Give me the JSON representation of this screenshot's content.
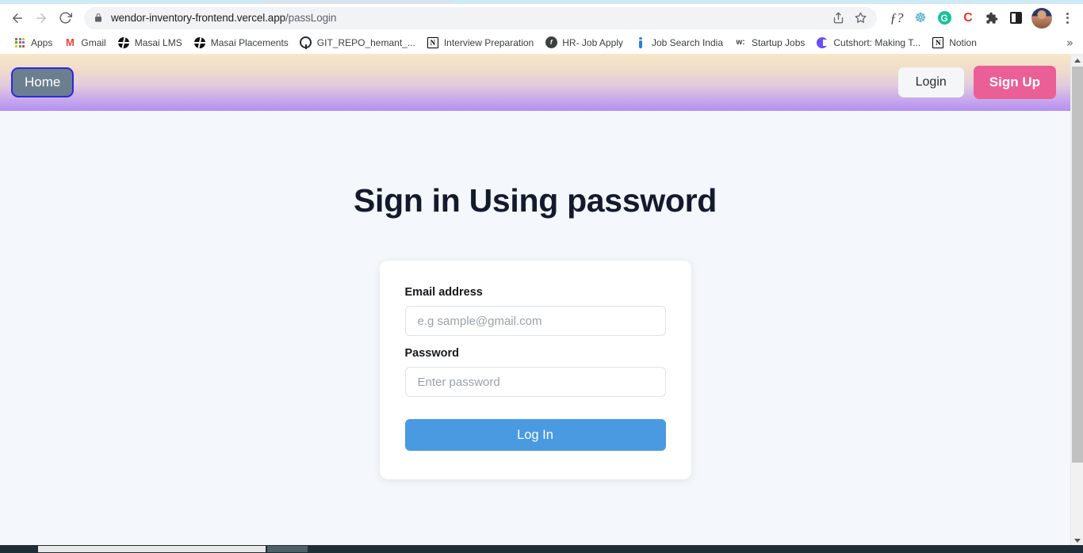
{
  "browser": {
    "back_icon": "back-arrow-icon",
    "forward_icon": "forward-arrow-icon",
    "reload_icon": "reload-icon",
    "url_domain": "wendor-inventory-frontend.vercel.app",
    "url_path": "/passLogin",
    "url_full": "wendor-inventory-frontend.vercel.app/passLogin",
    "lock_icon": "lock-icon",
    "share_icon": "share-icon",
    "bookmark_star_icon": "star-icon",
    "extensions": [
      {
        "name": "f-question-extension",
        "glyph": "ƒ?"
      },
      {
        "name": "globe-web-extension",
        "glyph": "☸"
      },
      {
        "name": "grammarly-extension",
        "glyph": "G"
      },
      {
        "name": "colon-c-extension",
        "glyph": "C"
      },
      {
        "name": "extensions-puzzle-icon",
        "glyph": "❖"
      },
      {
        "name": "sidepanel-icon",
        "glyph": "▣"
      }
    ],
    "avatar": "user-avatar",
    "menu_icon": "three-dot-menu-icon",
    "bookmarks": [
      {
        "label": "Apps",
        "icon": "apps-grid-icon"
      },
      {
        "label": "Gmail",
        "icon": "gmail-icon"
      },
      {
        "label": "Masai LMS",
        "icon": "masai-globe-icon"
      },
      {
        "label": "Masai Placements",
        "icon": "masai-globe-icon"
      },
      {
        "label": "GIT_REPO_hemant_...",
        "icon": "github-icon"
      },
      {
        "label": "Interview Preparation",
        "icon": "notion-icon"
      },
      {
        "label": "HR- Job Apply",
        "icon": "hr-icon"
      },
      {
        "label": "Job Search India",
        "icon": "job-search-icon"
      },
      {
        "label": "Startup Jobs",
        "icon": "wellfound-icon"
      },
      {
        "label": "Cutshort: Making T...",
        "icon": "cutshort-icon"
      },
      {
        "label": "Notion",
        "icon": "notion-icon"
      }
    ],
    "bookmarks_overflow": "»"
  },
  "navbar": {
    "home_label": "Home",
    "login_label": "Login",
    "signup_label": "Sign Up",
    "gradient_start": "#f8e7c6",
    "gradient_end": "#b490f2",
    "home_bg": "#6c7f90",
    "home_border": "#2b28e0",
    "signup_bg": "#ea5f96",
    "login_bg": "#f4f6f7"
  },
  "main": {
    "title": "Sign in Using password",
    "title_color": "#141a2e",
    "page_bg": "#f4f8fc",
    "form": {
      "email_label": "Email address",
      "email_value": "",
      "email_placeholder": "e.g sample@gmail.com",
      "password_label": "Password",
      "password_value": "",
      "password_placeholder": "Enter password",
      "submit_label": "Log In",
      "submit_bg": "#4a9ae1"
    }
  },
  "scrollbars": {
    "vertical_thumb_color": "#c1c1c1",
    "horizontal_track_color": "#1f2d38",
    "horizontal_thumb_color": "#e8e8e4"
  }
}
